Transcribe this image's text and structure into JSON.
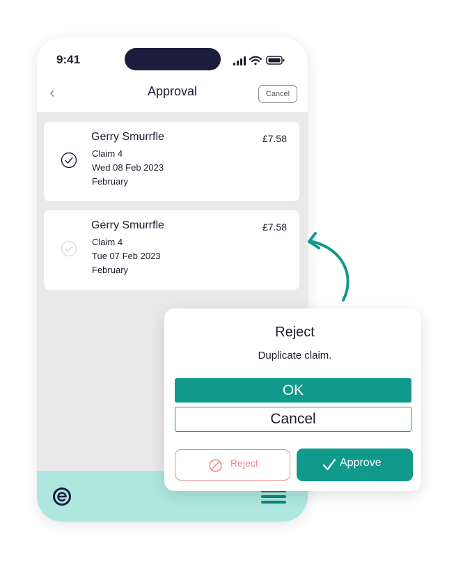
{
  "status_bar": {
    "time": "9:41",
    "icons": [
      "signal-icon",
      "wifi-icon",
      "battery-icon"
    ]
  },
  "nav": {
    "back_icon": "chevron-left-icon",
    "title": "Approval",
    "cancel_label": "Cancel"
  },
  "claims": [
    {
      "name": "Gerry Smurrfle",
      "claim": "Claim 4",
      "date": "Wed 08 Feb 2023",
      "month": "February",
      "amount": "£7.58",
      "selected": true
    },
    {
      "name": "Gerry Smurrfle",
      "claim": "Claim 4",
      "date": "Tue 07 Feb 2023",
      "month": "February",
      "amount": "£7.58",
      "selected": false
    }
  ],
  "bottom_bar": {
    "logo_icon": "e-logo-icon",
    "menu_icon": "hamburger-menu-icon"
  },
  "dialog": {
    "title": "Reject",
    "message": "Duplicate claim.",
    "ok_label": "OK",
    "cancel_label": "Cancel"
  },
  "actions": {
    "reject_label": "Reject",
    "approve_label": "Approve"
  },
  "colors": {
    "teal": "#109a8c",
    "mint": "#ade7df",
    "reject": "#ef8a8a",
    "navy": "#1c1c3c",
    "panel": "#e9e9e9"
  }
}
